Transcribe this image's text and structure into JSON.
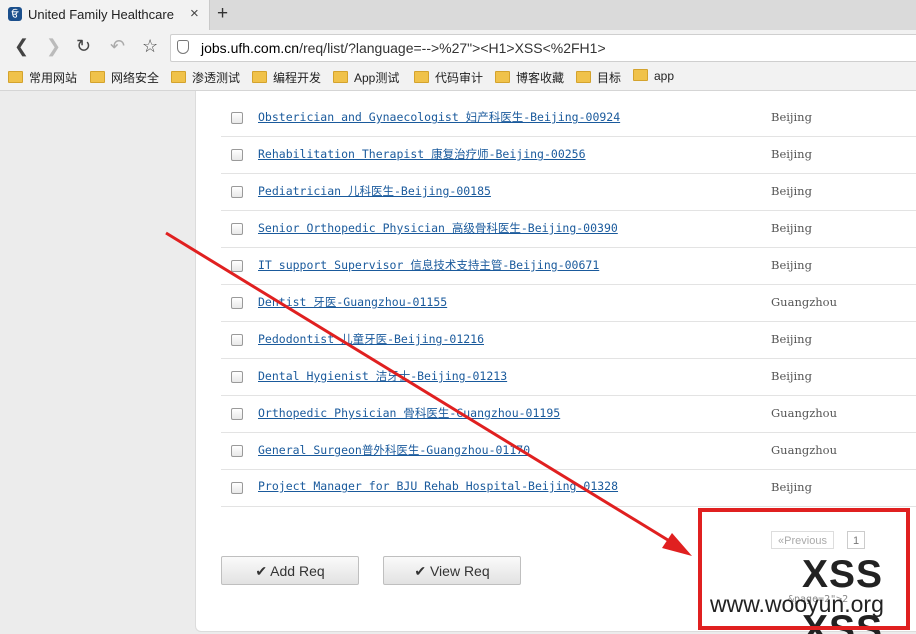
{
  "browser": {
    "tab_title": "United Family Healthcare",
    "tab_icon_text": "ਓ",
    "close": "×",
    "new_tab": "+",
    "url_domain": "jobs.ufh.com.cn",
    "url_path": "/req/list/?language=-->%27\"><H1>XSS<%2FH1>"
  },
  "bookmarks": [
    {
      "label": "常用网站"
    },
    {
      "label": "网络安全"
    },
    {
      "label": "渗透测试"
    },
    {
      "label": "编程开发"
    },
    {
      "label": "App测试"
    },
    {
      "label": "代码审计"
    },
    {
      "label": "博客收藏"
    },
    {
      "label": "目标"
    },
    {
      "label": "app"
    }
  ],
  "jobs": [
    {
      "title": "Obsterician and Gynaecologist 妇产科医生-Beijing-00924",
      "location": "Beijing"
    },
    {
      "title": "Rehabilitation Therapist 康复治疗师-Beijing-00256",
      "location": "Beijing"
    },
    {
      "title": "Pediatrician 儿科医生-Beijing-00185",
      "location": "Beijing"
    },
    {
      "title": "Senior Orthopedic Physician 高级骨科医生-Beijing-00390",
      "location": "Beijing"
    },
    {
      "title": "IT support Supervisor 信息技术支持主管-Beijing-00671",
      "location": "Beijing"
    },
    {
      "title": "Dentist 牙医-Guangzhou-01155",
      "location": "Guangzhou"
    },
    {
      "title": "Pedodontist 儿童牙医-Beijing-01216",
      "location": "Beijing"
    },
    {
      "title": "Dental Hygienist 洁牙士-Beijing-01213",
      "location": "Beijing"
    },
    {
      "title": "Orthopedic Physician 骨科医生-Guangzhou-01195",
      "location": "Guangzhou"
    },
    {
      "title": "General Surgeon普外科医生-Guangzhou-01170",
      "location": "Guangzhou"
    },
    {
      "title": "Project Manager for BJU Rehab Hospital-Beijing-01328",
      "location": "Beijing"
    }
  ],
  "buttons": {
    "add_req": "✔ Add Req",
    "view_req": "✔ View Req"
  },
  "pager": {
    "previous": "«Previous",
    "page": "1",
    "fragment": "&page=2\">2"
  },
  "injected": {
    "heading_1": "XSS",
    "heading_2": "XSS"
  },
  "watermark": "www.wooyun.org",
  "colors": {
    "highlight": "#e02020",
    "link": "#1a5a9c"
  }
}
